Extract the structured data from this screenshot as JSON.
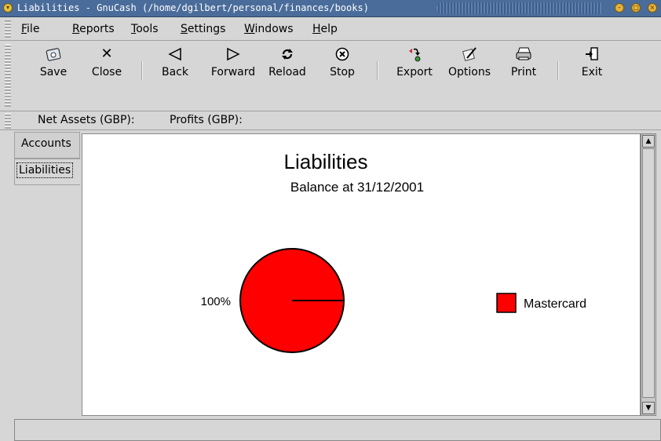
{
  "window": {
    "title": "Liabilities - GnuCash (/home/dgilbert/personal/finances/books)"
  },
  "menu": [
    "File",
    "Reports",
    "Tools",
    "Settings",
    "Windows",
    "Help"
  ],
  "toolbar": {
    "save": "Save",
    "close": "Close",
    "back": "Back",
    "forward": "Forward",
    "reload": "Reload",
    "stop": "Stop",
    "export": "Export",
    "options": "Options",
    "print": "Print",
    "exit": "Exit"
  },
  "icons": {
    "save": "floppy-disk-icon",
    "close": "x-icon",
    "back": "left-triangle-icon",
    "forward": "right-triangle-icon",
    "reload": "reload-icon",
    "stop": "stop-icon",
    "export": "export-icon",
    "options": "options-icon",
    "print": "printer-icon",
    "exit": "exit-door-icon"
  },
  "summary": {
    "net_assets": "Net Assets (GBP):",
    "profits": "Profits (GBP):"
  },
  "tabs": [
    "Accounts",
    "Liabilities"
  ],
  "active_tab": "Liabilities",
  "chart_data": {
    "type": "pie",
    "title": "Liabilities",
    "subtitle": "Balance at 31/12/2001",
    "slices": [
      {
        "label": "Mastercard",
        "value": 100,
        "percent_label": "100%",
        "color": "#ff0000"
      }
    ],
    "legend": "right"
  },
  "colors": {
    "titlebar": "#4a6c9a",
    "slice": "#ff0000"
  }
}
